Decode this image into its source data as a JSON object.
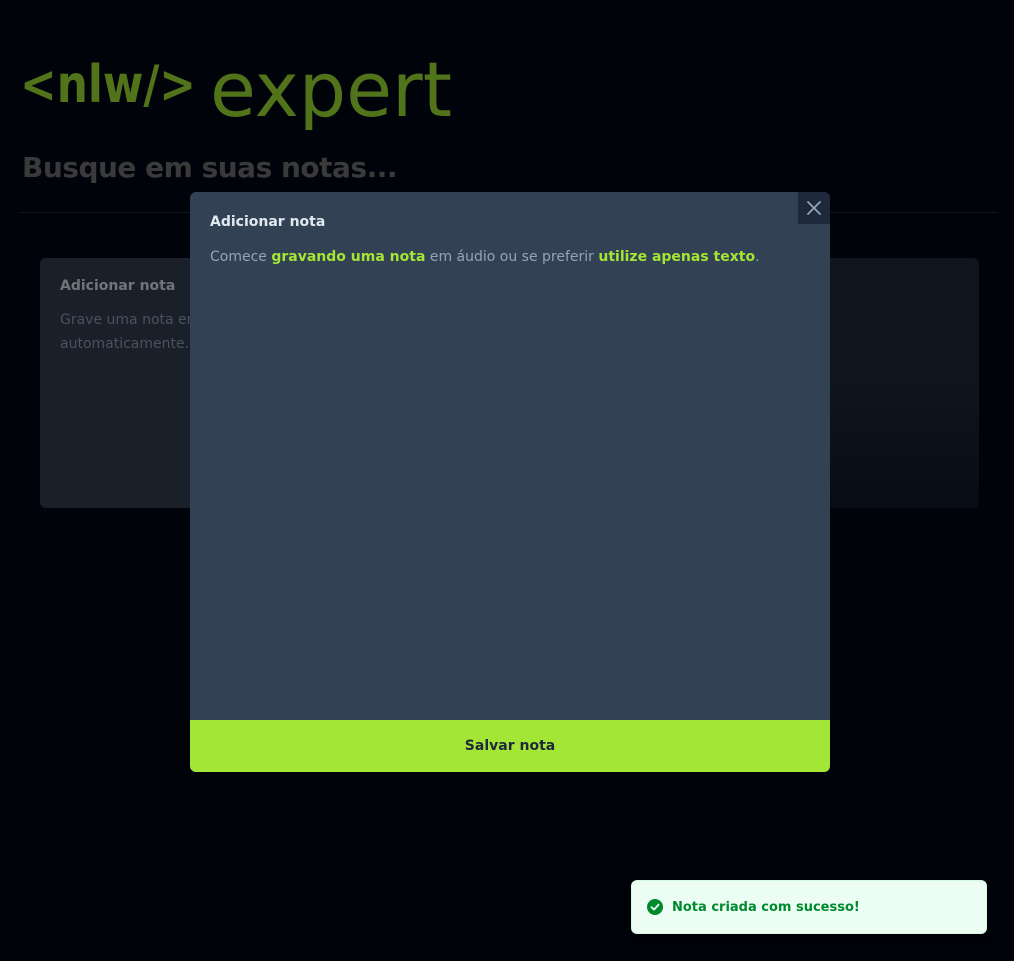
{
  "logo": {
    "tag_text": "<nlw/>",
    "brand_text": "expert"
  },
  "search": {
    "placeholder": "Busque em suas notas..."
  },
  "add_note_card": {
    "title": "Adicionar nota",
    "description_line1": "Grave uma nota em á",
    "description_line2": "automaticamente."
  },
  "dialog": {
    "title": "Adicionar nota",
    "text_prefix": "Comece ",
    "record_link": "gravando uma nota",
    "text_middle": " em áudio ou se preferir ",
    "text_link": "utilize apenas texto",
    "text_suffix": ".",
    "save_label": "Salvar nota",
    "close_icon": "close-icon"
  },
  "toast": {
    "message": "Nota criada com sucesso!",
    "icon": "check-circle-icon"
  },
  "colors": {
    "accent": "#a3e635",
    "background": "#020617",
    "dialog_bg": "#334155",
    "toast_bg": "#ecfdf3",
    "toast_text": "#008a2e"
  }
}
